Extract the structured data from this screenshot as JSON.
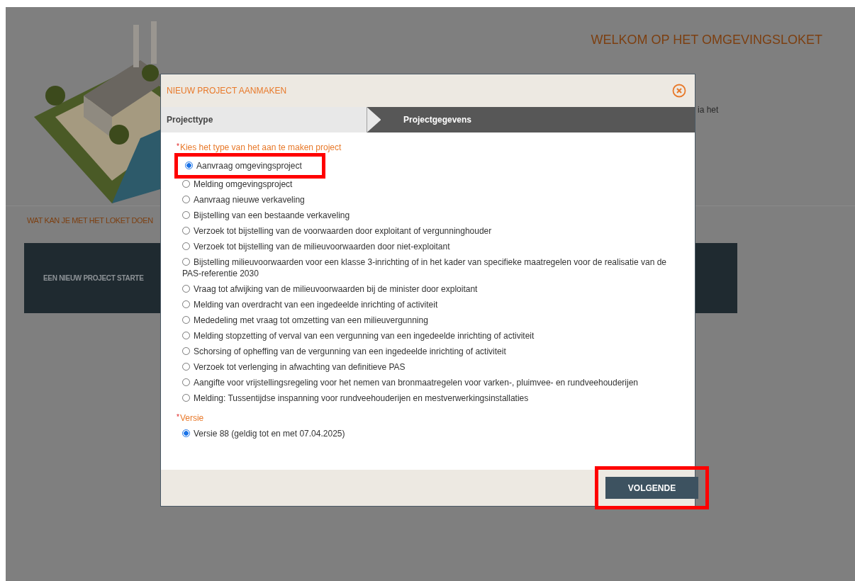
{
  "page": {
    "title": "WELKOM OP HET OMGEVINGSLOKET",
    "intro_fragment": "ia het",
    "section_heading": "WAT KAN JE MET HET LOKET DOEN",
    "card_label": "EEN NIEUW PROJECT STARTE"
  },
  "dialog": {
    "title": "NIEUW PROJECT AANMAKEN",
    "steps": [
      {
        "label": "Projecttype",
        "selected": true
      },
      {
        "label": "Projectgegevens",
        "selected": false
      }
    ],
    "type_field": {
      "label": "Kies het type van het aan te maken project",
      "marker": "*",
      "options": [
        {
          "label": "Aanvraag omgevingsproject",
          "selected": true,
          "highlighted": true
        },
        {
          "label": "Melding omgevingsproject",
          "selected": false,
          "highlighted": false
        },
        {
          "label": "Aanvraag nieuwe verkaveling",
          "selected": false,
          "highlighted": false
        },
        {
          "label": "Bijstelling van een bestaande verkaveling",
          "selected": false,
          "highlighted": false
        },
        {
          "label": "Verzoek tot bijstelling van de voorwaarden door exploitant of vergunninghouder",
          "selected": false,
          "highlighted": false
        },
        {
          "label": "Verzoek tot bijstelling van de milieuvoorwaarden door niet-exploitant",
          "selected": false,
          "highlighted": false
        },
        {
          "label": "Bijstelling milieuvoorwaarden voor een klasse 3-inrichting of in het kader van specifieke maatregelen voor de realisatie van de PAS-referentie 2030",
          "selected": false,
          "highlighted": false
        },
        {
          "label": "Vraag tot afwijking van de milieuvoorwaarden bij de minister door exploitant",
          "selected": false,
          "highlighted": false
        },
        {
          "label": "Melding van overdracht van een ingedeelde inrichting of activiteit",
          "selected": false,
          "highlighted": false
        },
        {
          "label": "Mededeling met vraag tot omzetting van een milieuvergunning",
          "selected": false,
          "highlighted": false
        },
        {
          "label": "Melding stopzetting of verval van een vergunning van een ingedeelde inrichting of activiteit",
          "selected": false,
          "highlighted": false
        },
        {
          "label": "Schorsing of opheffing van de vergunning van een ingedeelde inrichting of activiteit",
          "selected": false,
          "highlighted": false
        },
        {
          "label": "Verzoek tot verlenging in afwachting van definitieve PAS",
          "selected": false,
          "highlighted": false
        },
        {
          "label": "Aangifte voor vrijstellingsregeling voor het nemen van bronmaatregelen voor varken-, pluimvee- en rundveehouderijen",
          "selected": false,
          "highlighted": false
        },
        {
          "label": "Melding: Tussentijdse inspanning voor rundveehouderijen en mestverwerkingsinstallaties",
          "selected": false,
          "highlighted": false
        }
      ]
    },
    "version_field": {
      "label": "Versie",
      "marker": "*",
      "options": [
        {
          "label": "Versie 88 (geldig tot en met 07.04.2025)",
          "selected": true,
          "highlighted": false
        }
      ]
    },
    "next_button": {
      "label": "VOLGENDE",
      "highlighted": true
    }
  }
}
